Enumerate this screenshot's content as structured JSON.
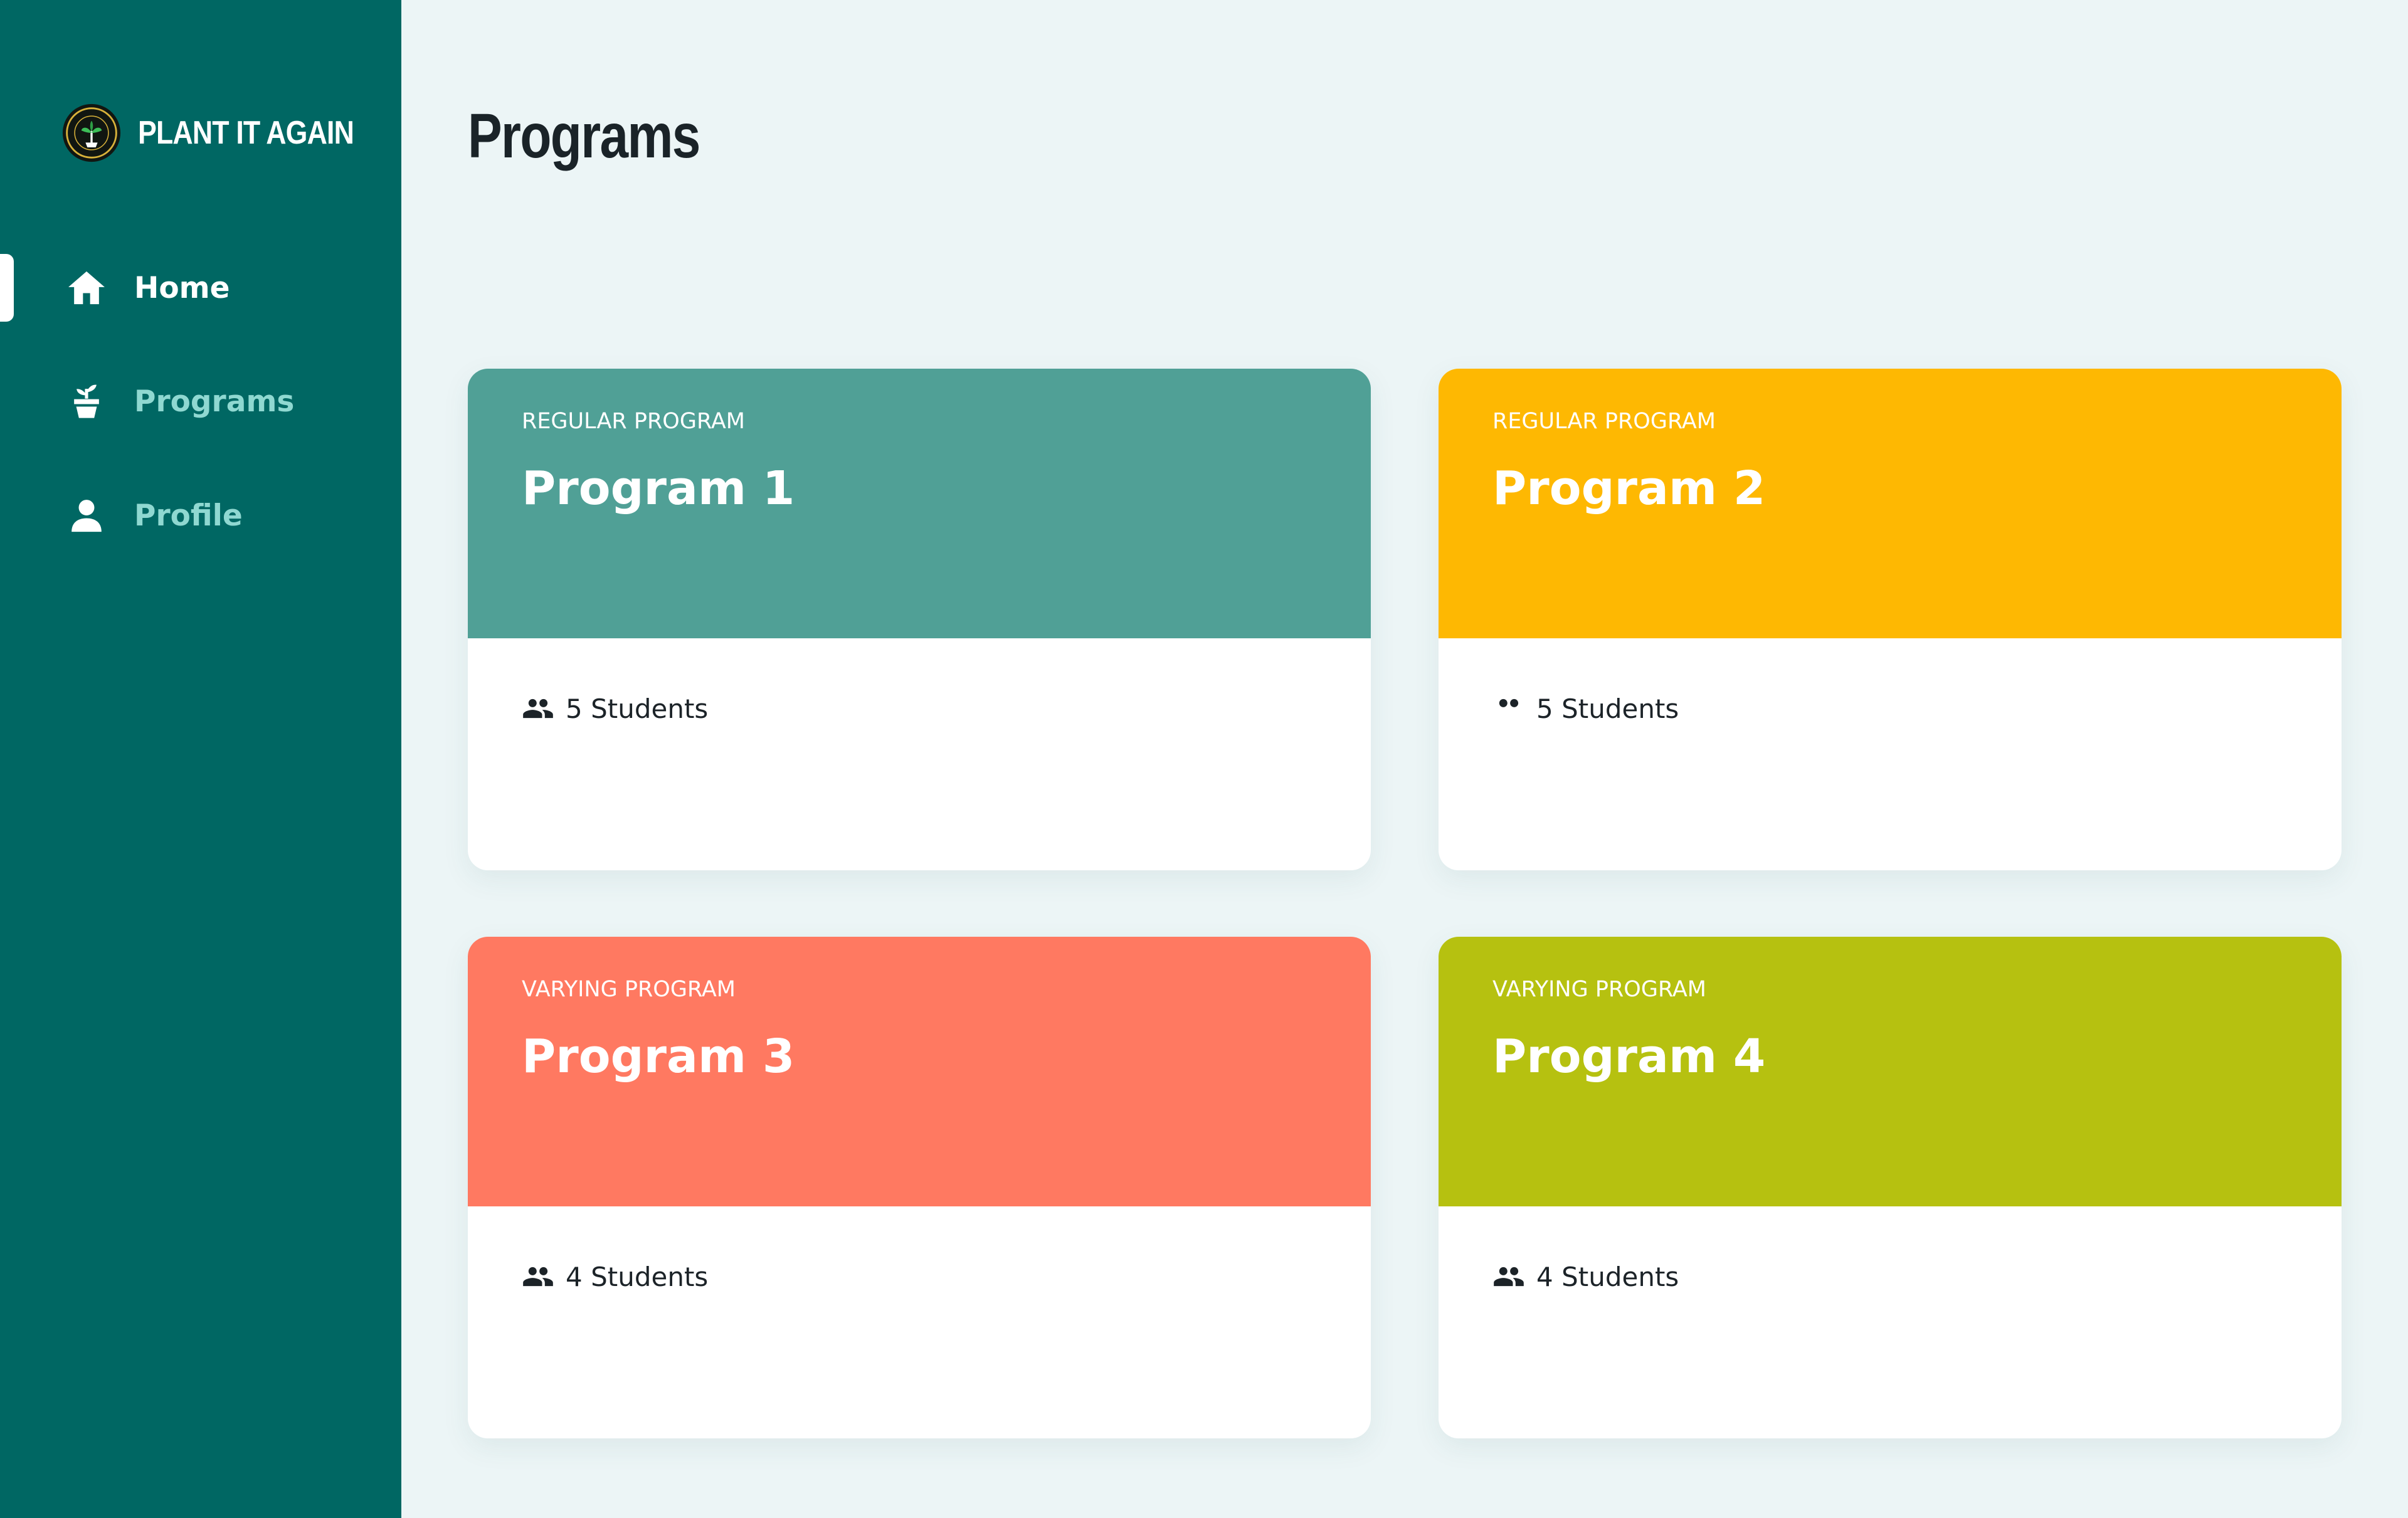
{
  "sidebar": {
    "brand": {
      "name": "PLANT IT AGAIN",
      "logo_icon": "plant-it-again-seal-logo"
    },
    "items": [
      {
        "label": "Home",
        "icon": "home-icon",
        "active": true
      },
      {
        "label": "Programs",
        "icon": "plant-pot-icon",
        "active": false
      },
      {
        "label": "Profile",
        "icon": "person-icon",
        "active": false
      }
    ],
    "colors": {
      "background": "#006763",
      "active_text": "#FFFFFF",
      "inactive_text": "#8FD8D1"
    }
  },
  "main": {
    "title": "Programs",
    "background": "#ECF5F6",
    "cards": [
      {
        "type": "REGULAR PROGRAM",
        "title": "Program 1",
        "students": "5 Students",
        "color": "#50A096",
        "icon": "people-icon"
      },
      {
        "type": "REGULAR PROGRAM",
        "title": "Program 2",
        "students": "5 Students",
        "color": "#FEB802",
        "icon": "people-icon"
      },
      {
        "type": "VARYING PROGRAM",
        "title": "Program 3",
        "students": "4 Students",
        "color": "#FF7961",
        "icon": "people-icon"
      },
      {
        "type": "VARYING PROGRAM",
        "title": "Program 4",
        "students": "4 Students",
        "color": "#B6C110",
        "icon": "people-icon"
      }
    ]
  }
}
